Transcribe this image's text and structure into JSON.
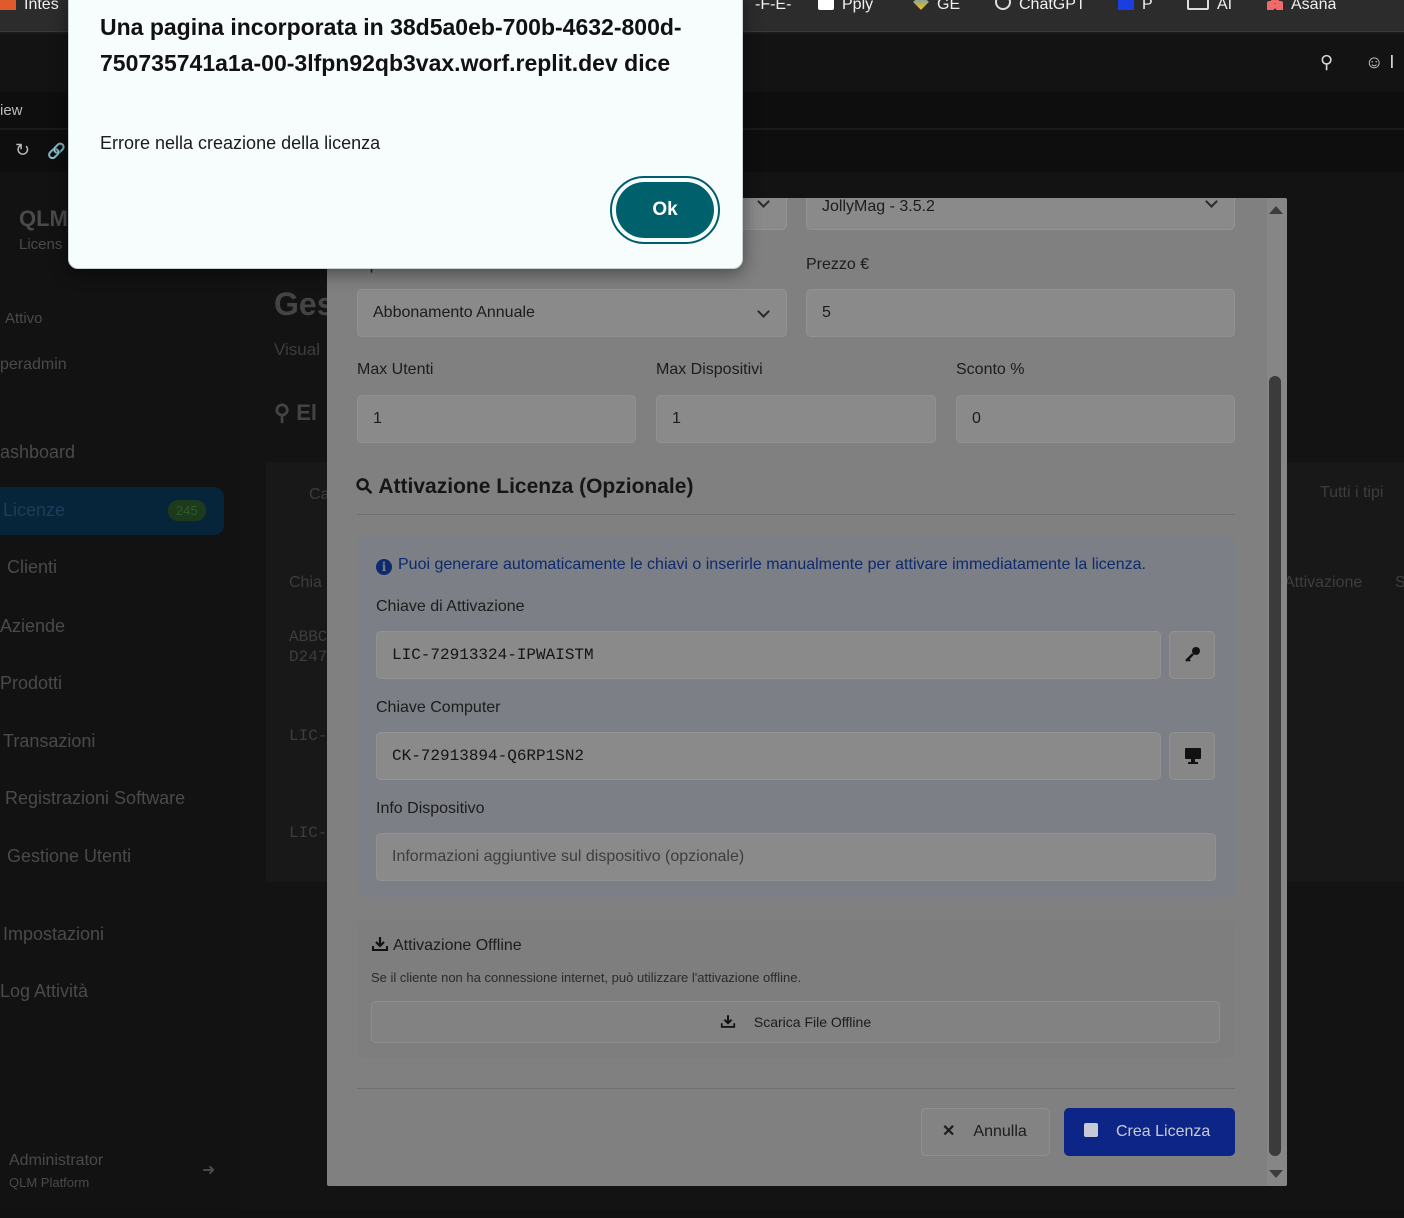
{
  "bookmarks": [
    {
      "label": "Intes",
      "icon": "bank-icon"
    },
    {
      "label": "-F-E-",
      "icon": ""
    },
    {
      "label": "Pply",
      "icon": "pply-icon"
    },
    {
      "label": "GE",
      "icon": "gemini-icon"
    },
    {
      "label": "ChatGPT",
      "icon": "chatgpt-icon"
    },
    {
      "label": "P",
      "icon": "p-icon"
    },
    {
      "label": "AI",
      "icon": "window-icon"
    },
    {
      "label": "Asana",
      "icon": "asana-icon"
    }
  ],
  "browser": {
    "tab_label": "iew",
    "topbar_partial": "I"
  },
  "app": {
    "brand": "QLM",
    "brand_sub": "Licens",
    "status": "Attivo",
    "user_select": "peradmin",
    "nav": [
      {
        "label": "ashboard"
      },
      {
        "label": "Licenze",
        "badge": "245"
      },
      {
        "label": "Clienti"
      },
      {
        "label": "Aziende"
      },
      {
        "label": "Prodotti"
      },
      {
        "label": "Transazioni"
      },
      {
        "label": "Registrazioni Software"
      },
      {
        "label": "Gestione Utenti"
      },
      {
        "label": "Impostazioni"
      },
      {
        "label": "Log Attività"
      }
    ],
    "footer_user": "Administrator",
    "footer_sub": "QLM Platform",
    "page_title": "Ges",
    "page_sub": "Visual",
    "section_title": "El",
    "filter_left": "Ca",
    "filter_right": "Tutti i tipi",
    "col_left": "Chia",
    "col_right": "Attivazione",
    "col_far": "S",
    "row1_a": "ABBC",
    "row1_b": "D247",
    "row2": "LIC-",
    "row3": "LIC-"
  },
  "modal": {
    "product_value": "JollyMag - 3.5.2",
    "license_type_label": "Tipo Licenza",
    "license_type_value": "Abbonamento Annuale",
    "price_label": "Prezzo €",
    "price_value": "5",
    "max_users_label": "Max Utenti",
    "max_users_value": "1",
    "max_devices_label": "Max Dispositivi",
    "max_devices_value": "1",
    "discount_label": "Sconto %",
    "discount_value": "0",
    "activation_title": "Attivazione Licenza (Opzionale)",
    "activation_info": "Puoi generare automaticamente le chiavi o inserirle manualmente per attivare immediatamente la licenza.",
    "activation_key_label": "Chiave di Attivazione",
    "activation_key_value": "LIC-72913324-IPWAISTM",
    "computer_key_label": "Chiave Computer",
    "computer_key_value": "CK-72913894-Q6RP1SN2",
    "device_info_label": "Info Dispositivo",
    "device_info_placeholder": "Informazioni aggiuntive sul dispositivo (opzionale)",
    "offline_title": "Attivazione Offline",
    "offline_note": "Se il cliente non ha connessione internet, può utilizzare l'attivazione offline.",
    "offline_button": "Scarica File Offline",
    "cancel_button": "Annulla",
    "create_button": "Crea Licenza"
  },
  "dialog": {
    "title": "Una pagina incorporata in 38d5a0eb-700b-4632-800d-750735741a1a-00-3lfpn92qb3vax.worf.replit.dev dice",
    "message": "Errore nella creazione della licenza",
    "ok_label": "Ok"
  },
  "colors": {
    "ok_button": "#00606b",
    "create_button": "#0d2587",
    "info_text": "#0d2a6e"
  }
}
